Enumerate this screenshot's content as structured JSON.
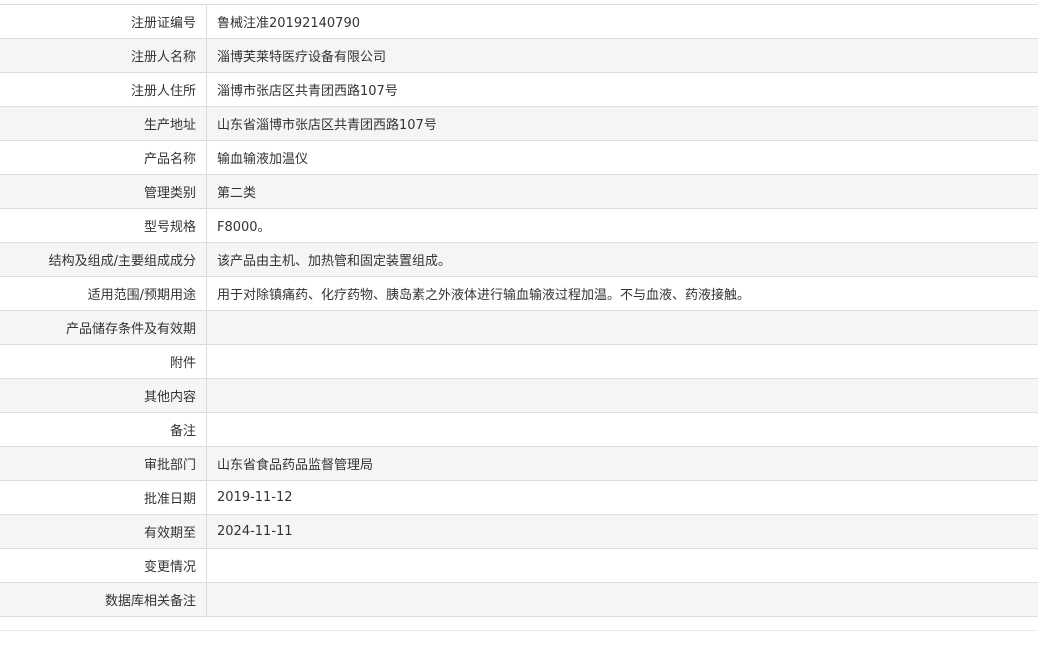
{
  "rows": [
    {
      "label": "注册证编号",
      "value": "鲁械注准20192140790"
    },
    {
      "label": "注册人名称",
      "value": "淄博芙莱特医疗设备有限公司"
    },
    {
      "label": "注册人住所",
      "value": "淄博市张店区共青团西路107号"
    },
    {
      "label": "生产地址",
      "value": "山东省淄博市张店区共青团西路107号"
    },
    {
      "label": "产品名称",
      "value": "输血输液加温仪"
    },
    {
      "label": "管理类别",
      "value": "第二类"
    },
    {
      "label": "型号规格",
      "value": "F8000。"
    },
    {
      "label": "结构及组成/主要组成成分",
      "value": "该产品由主机、加热管和固定装置组成。"
    },
    {
      "label": "适用范围/预期用途",
      "value": "用于对除镇痛药、化疗药物、胰岛素之外液体进行输血输液过程加温。不与血液、药液接触。"
    },
    {
      "label": "产品储存条件及有效期",
      "value": ""
    },
    {
      "label": "附件",
      "value": ""
    },
    {
      "label": "其他内容",
      "value": ""
    },
    {
      "label": "备注",
      "value": ""
    },
    {
      "label": "审批部门",
      "value": "山东省食品药品监督管理局"
    },
    {
      "label": "批准日期",
      "value": "2019-11-12"
    },
    {
      "label": "有效期至",
      "value": "2024-11-11"
    },
    {
      "label": "变更情况",
      "value": ""
    },
    {
      "label": "数据库相关备注",
      "value": ""
    }
  ]
}
